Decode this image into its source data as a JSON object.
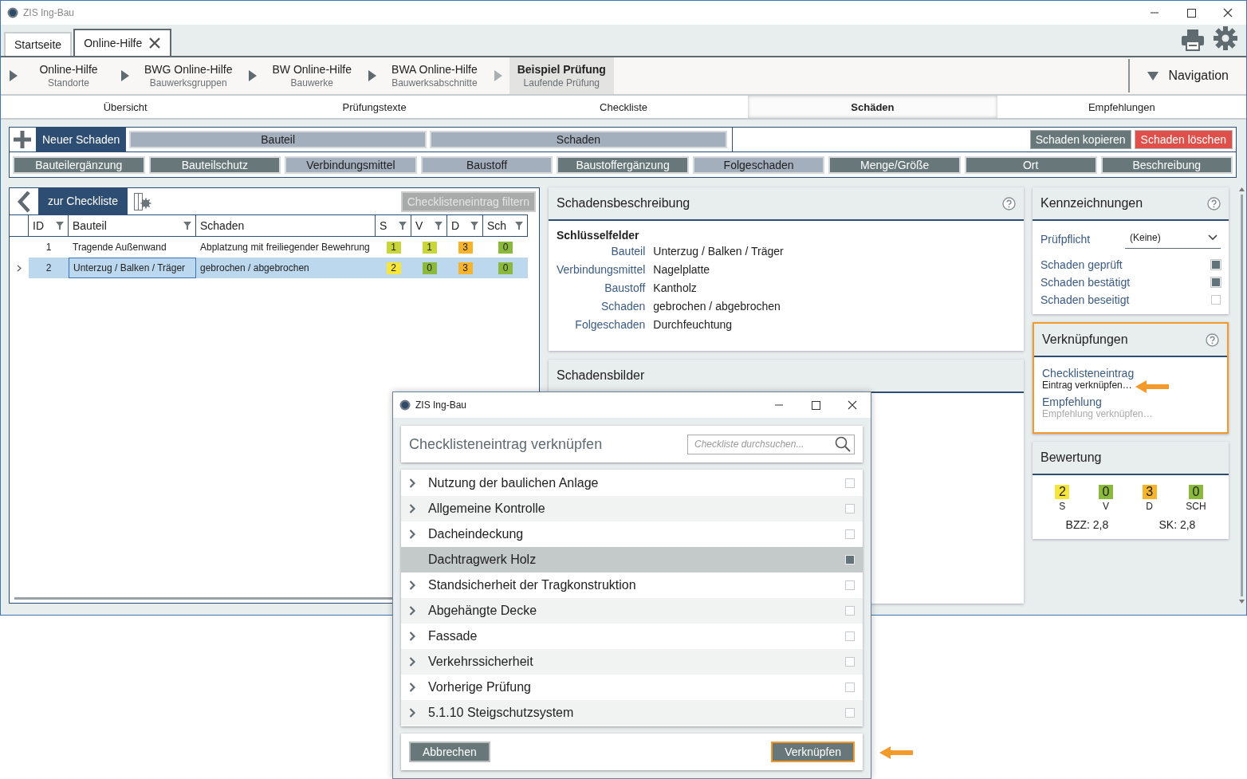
{
  "window": {
    "title": "ZIS Ing-Bau"
  },
  "tabs": [
    {
      "label": "Startseite",
      "selected": false,
      "closable": false
    },
    {
      "label": "Online-Hilfe",
      "selected": true,
      "closable": true
    }
  ],
  "breadcrumb": [
    {
      "title": "Online-Hilfe",
      "subtitle": "Standorte",
      "selected": false
    },
    {
      "title": "BWG Online-Hilfe",
      "subtitle": "Bauwerksgruppen",
      "selected": false
    },
    {
      "title": "BW Online-Hilfe",
      "subtitle": "Bauwerke",
      "selected": false
    },
    {
      "title": "BWA Online-Hilfe",
      "subtitle": "Bauwerksabschnitte",
      "selected": false
    },
    {
      "title": "Beispiel Prüfung",
      "subtitle": "Laufende Prüfung",
      "selected": true
    }
  ],
  "navigation": {
    "label": "Navigation"
  },
  "section_tabs": [
    {
      "label": "Übersicht",
      "selected": false
    },
    {
      "label": "Prüfungstexte",
      "selected": false
    },
    {
      "label": "Checkliste",
      "selected": false
    },
    {
      "label": "Schäden",
      "selected": true
    },
    {
      "label": "Empfehlungen",
      "selected": false
    }
  ],
  "toolbar": {
    "new_button": "Neuer Schaden",
    "key_fields": [
      {
        "label": "Bauteil",
        "filled": true
      },
      {
        "label": "Schaden",
        "filled": true
      }
    ],
    "copy_button": "Schaden kopieren",
    "delete_button": "Schaden löschen",
    "field_buttons": [
      {
        "label": "Bauteilergänzung",
        "filled": false
      },
      {
        "label": "Bauteilschutz",
        "filled": false
      },
      {
        "label": "Verbindungsmittel",
        "filled": true
      },
      {
        "label": "Baustoff",
        "filled": true
      },
      {
        "label": "Baustoffergänzung",
        "filled": false
      },
      {
        "label": "Folgeschaden",
        "filled": true
      },
      {
        "label": "Menge/Größe",
        "filled": false
      },
      {
        "label": "Ort",
        "filled": false
      },
      {
        "label": "Beschreibung",
        "filled": false
      }
    ]
  },
  "list_panel": {
    "back_button": "zur Checkliste",
    "filter_button": {
      "label": "Checklisteneintrag filtern",
      "disabled": true
    },
    "columns": [
      {
        "label": "ID",
        "filter": true
      },
      {
        "label": "Bauteil",
        "filter": true
      },
      {
        "label": "Schaden",
        "filter": false
      },
      {
        "label": "S",
        "filter": true
      },
      {
        "label": "V",
        "filter": true
      },
      {
        "label": "D",
        "filter": true
      },
      {
        "label": "Sch",
        "filter": true
      }
    ],
    "rows": [
      {
        "id": "1",
        "bauteil": "Tragende Außenwand",
        "schaden": "Abplatzung mit freiliegender Bewehrung",
        "selected": false,
        "ratings": [
          {
            "value": "1",
            "color": "#c8d63c"
          },
          {
            "value": "1",
            "color": "#c8d63c"
          },
          {
            "value": "3",
            "color": "#f6b42c"
          },
          {
            "value": "0",
            "color": "#8bb93c"
          }
        ]
      },
      {
        "id": "2",
        "bauteil": "Unterzug / Balken / Träger",
        "schaden": "gebrochen / abgebrochen",
        "selected": true,
        "ratings": [
          {
            "value": "2",
            "color": "#f6e63c"
          },
          {
            "value": "0",
            "color": "#8bb93c"
          },
          {
            "value": "3",
            "color": "#f6b42c"
          },
          {
            "value": "0",
            "color": "#8bb93c"
          }
        ]
      }
    ]
  },
  "description": {
    "title": "Schadensbeschreibung",
    "section": "Schlüsselfelder",
    "fields": [
      {
        "label": "Bauteil",
        "value": "Unterzug / Balken / Träger"
      },
      {
        "label": "Verbindungsmittel",
        "value": "Nagelplatte"
      },
      {
        "label": "Baustoff",
        "value": "Kantholz"
      },
      {
        "label": "Schaden",
        "value": "gebrochen / abgebrochen"
      },
      {
        "label": "Folgeschaden",
        "value": "Durchfeuchtung"
      }
    ]
  },
  "images": {
    "title": "Schadensbilder"
  },
  "markings": {
    "title": "Kennzeichnungen",
    "pruefpflicht": {
      "label": "Prüfpflicht",
      "value": "(Keine)"
    },
    "flags": [
      {
        "label": "Schaden geprüft",
        "checked": true
      },
      {
        "label": "Schaden bestätigt",
        "checked": true
      },
      {
        "label": "Schaden beseitigt",
        "checked": false
      }
    ]
  },
  "links": {
    "title": "Verknüpfungen",
    "highlighted": true,
    "items": [
      {
        "label": "Checklisteneintrag",
        "action": "Eintrag verknüpfen…",
        "disabled": false
      },
      {
        "label": "Empfehlung",
        "action": "Empfehlung verknüpfen…",
        "disabled": true
      }
    ]
  },
  "rating": {
    "title": "Bewertung",
    "scores": [
      {
        "value": "2",
        "label": "S",
        "color": "#f6e63c"
      },
      {
        "value": "0",
        "label": "V",
        "color": "#8bb93c"
      },
      {
        "value": "3",
        "label": "D",
        "color": "#f6b42c"
      },
      {
        "value": "0",
        "label": "SCH",
        "color": "#8bb93c"
      }
    ],
    "summary": [
      "BZZ: 2,8",
      "SK: 2,8"
    ]
  },
  "dialog": {
    "title": "ZIS Ing-Bau",
    "heading": "Checklisteneintrag verknüpfen",
    "search": {
      "placeholder": "Checkliste durchsuchen..."
    },
    "items": [
      {
        "label": "Nutzung der baulichen Anlage",
        "expandable": true,
        "selected": false,
        "checked": false
      },
      {
        "label": "Allgemeine Kontrolle",
        "expandable": true,
        "selected": false,
        "checked": false
      },
      {
        "label": "Dacheindeckung",
        "expandable": true,
        "selected": false,
        "checked": false
      },
      {
        "label": "Dachtragwerk Holz",
        "expandable": false,
        "selected": true,
        "checked": true
      },
      {
        "label": "Standsicherheit der Tragkonstruktion",
        "expandable": true,
        "selected": false,
        "checked": false
      },
      {
        "label": "Abgehängte Decke",
        "expandable": true,
        "selected": false,
        "checked": false
      },
      {
        "label": "Fassade",
        "expandable": true,
        "selected": false,
        "checked": false
      },
      {
        "label": "Verkehrssicherheit",
        "expandable": true,
        "selected": false,
        "checked": false
      },
      {
        "label": "Vorherige Prüfung",
        "expandable": true,
        "selected": false,
        "checked": false
      },
      {
        "label": "5.1.10 Steigschutzsystem",
        "expandable": true,
        "selected": false,
        "checked": false
      }
    ],
    "cancel_button": "Abbrechen",
    "confirm_button": {
      "label": "Verknüpfen",
      "focused": true
    }
  }
}
